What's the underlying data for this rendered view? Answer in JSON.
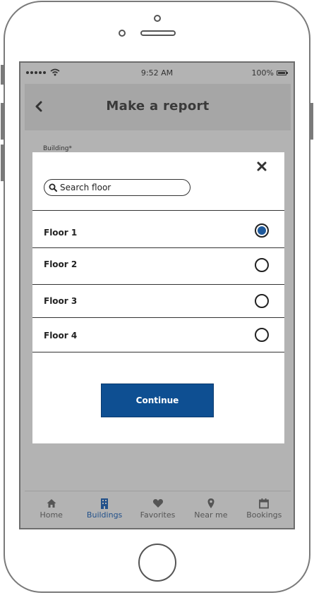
{
  "status_bar": {
    "signal_dots": "•••••",
    "time": "9:52 AM",
    "battery": "100%"
  },
  "header": {
    "title": "Make a report"
  },
  "form": {
    "building_label": "Building*"
  },
  "modal": {
    "search_placeholder": "Search floor",
    "floors": [
      {
        "label": "Floor 1",
        "selected": true
      },
      {
        "label": "Floor 2",
        "selected": false
      },
      {
        "label": "Floor 3",
        "selected": false
      },
      {
        "label": "Floor 4",
        "selected": false
      }
    ],
    "continue_label": "Continue"
  },
  "tabs": [
    {
      "label": "Home",
      "icon": "home-icon",
      "active": false
    },
    {
      "label": "Buildings",
      "icon": "building-icon",
      "active": true
    },
    {
      "label": "Favorites",
      "icon": "heart-icon",
      "active": false
    },
    {
      "label": "Near me",
      "icon": "location-pin-icon",
      "active": false
    },
    {
      "label": "Bookings",
      "icon": "calendar-icon",
      "active": false
    }
  ],
  "colors": {
    "accent": "#0e4f92",
    "selected_radio": "#1f5a9c",
    "active_tab": "#23518a",
    "overlay": "#b3b3b3"
  }
}
